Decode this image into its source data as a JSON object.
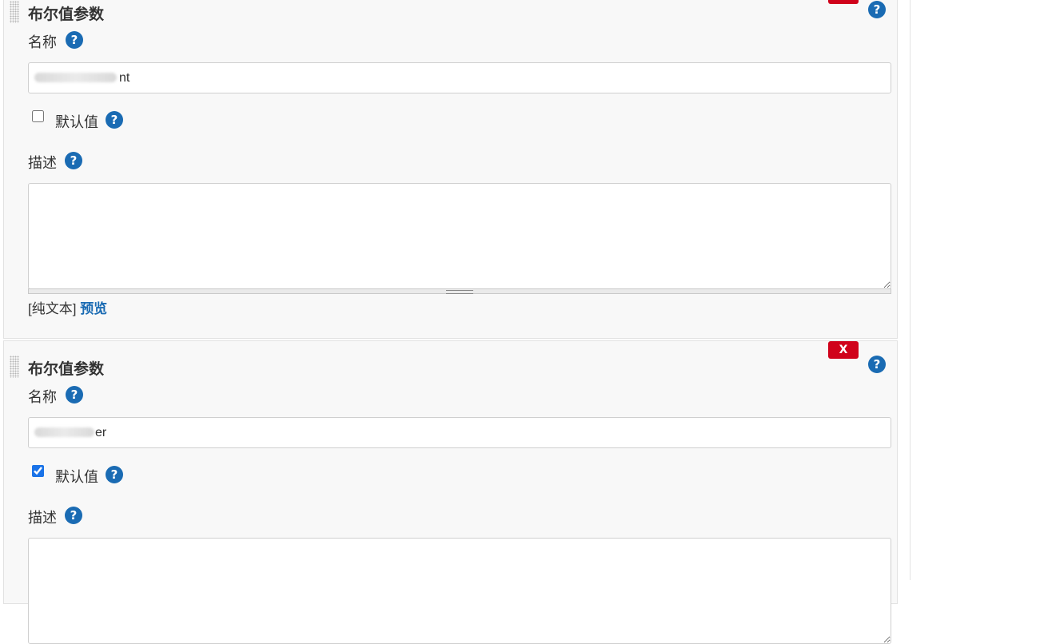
{
  "params": [
    {
      "title": "布尔值参数",
      "remove_label": "X",
      "name_label": "名称",
      "name_value": "nt",
      "default_label": "默认值",
      "default_checked": false,
      "desc_label": "描述",
      "desc_value": "",
      "format_label": "[纯文本]",
      "preview_label": "预览"
    },
    {
      "title": "布尔值参数",
      "remove_label": "X",
      "name_label": "名称",
      "name_value": "er",
      "default_label": "默认值",
      "default_checked": true,
      "desc_label": "描述",
      "desc_value": ""
    }
  ],
  "help_glyph": "?",
  "colors": {
    "help": "#1a6bb3",
    "remove": "#d0021b",
    "panel_bg": "#f8f8f8",
    "link": "#1a6bb3"
  }
}
